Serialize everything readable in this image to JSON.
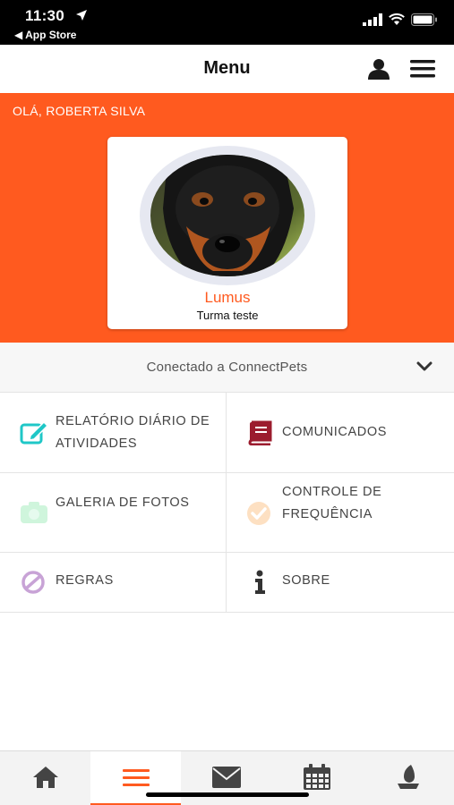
{
  "status_bar": {
    "time": "11:30",
    "back_app": "◀ App Store"
  },
  "header": {
    "title": "Menu",
    "user_icon": "user-icon",
    "menu_icon": "hamburger-menu-icon"
  },
  "hero": {
    "greeting": "OLÁ, ROBERTA SILVA",
    "pet_name": "Lumus",
    "pet_class": "Turma teste",
    "accent_color": "#ff5a1f"
  },
  "connection": {
    "label": "Conectado a ConnectPets",
    "icon": "chevron-down-icon"
  },
  "menu_items": [
    {
      "label": "RELATÓRIO DIÁRIO DE ATIVIDADES",
      "icon": "edit-report-icon",
      "color": "#1fc7c7"
    },
    {
      "label": "COMUNICADOS",
      "icon": "book-icon",
      "color": "#9b1c2e"
    },
    {
      "label": "GALERIA DE FOTOS",
      "icon": "camera-icon",
      "color": "#cff5dc"
    },
    {
      "label": "CONTROLE DE FREQUÊNCIA",
      "icon": "check-circle-icon",
      "color": "#fde0c2"
    },
    {
      "label": "REGRAS",
      "icon": "ban-icon",
      "color": "#c8a3d6"
    },
    {
      "label": "SOBRE",
      "icon": "info-icon",
      "color": "#333333"
    }
  ],
  "tab_bar": {
    "tabs": [
      {
        "name": "home",
        "icon": "home-icon"
      },
      {
        "name": "menu",
        "icon": "menu-icon",
        "active": true
      },
      {
        "name": "messages",
        "icon": "mail-icon"
      },
      {
        "name": "calendar",
        "icon": "calendar-icon"
      },
      {
        "name": "feeding",
        "icon": "bowl-icon"
      }
    ]
  }
}
